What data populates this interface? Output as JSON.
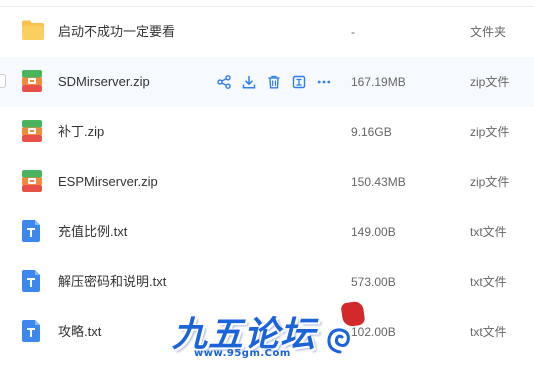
{
  "colors": {
    "accent": "#2f7ff0",
    "folder": "#f9c24a",
    "txt_icon": "#3d88ef",
    "zip_green": "#49b35e",
    "zip_orange": "#f18a3b",
    "zip_red": "#e7514a",
    "hover_row": "#f6f9ff"
  },
  "files": [
    {
      "icon": "folder-icon",
      "name": "启动不成功一定要看",
      "size": "-",
      "type": "文件夹"
    },
    {
      "icon": "zip-icon",
      "name": "SDMirserver.zip",
      "size": "167.19MB",
      "type": "zip文件"
    },
    {
      "icon": "zip-icon",
      "name": "补丁.zip",
      "size": "9.16GB",
      "type": "zip文件"
    },
    {
      "icon": "zip-icon",
      "name": "ESPMirserver.zip",
      "size": "150.43MB",
      "type": "zip文件"
    },
    {
      "icon": "txt-icon",
      "name": "充值比例.txt",
      "size": "149.00B",
      "type": "txt文件"
    },
    {
      "icon": "txt-icon",
      "name": "解压密码和说明.txt",
      "size": "573.00B",
      "type": "txt文件"
    },
    {
      "icon": "txt-icon",
      "name": "攻略.txt",
      "size": "102.00B",
      "type": "txt文件"
    }
  ],
  "row_actions": [
    {
      "icon": "share-icon"
    },
    {
      "icon": "download-icon"
    },
    {
      "icon": "trash-icon"
    },
    {
      "icon": "move-icon"
    },
    {
      "icon": "more-icon"
    }
  ],
  "watermark": {
    "title": "九五论坛",
    "url": "www.95gm.Com"
  }
}
